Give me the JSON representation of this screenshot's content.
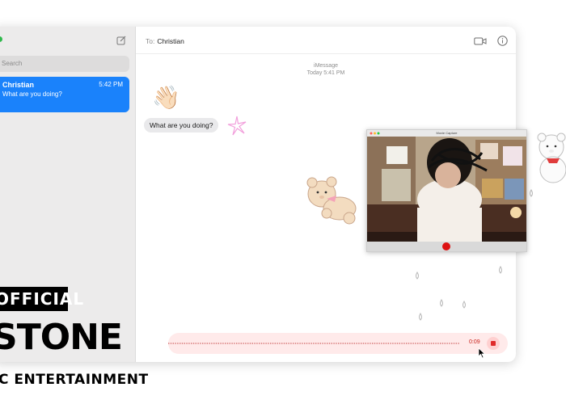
{
  "sidebar": {
    "search_placeholder": "Search",
    "conversations": [
      {
        "name": "Christian",
        "time": "5:42 PM",
        "preview": "What are you doing?"
      }
    ]
  },
  "header": {
    "to_label": "To:",
    "recipient": "Christian"
  },
  "thread": {
    "service": "iMessage",
    "timestamp": "Today 5:41 PM",
    "messages": [
      {
        "type": "emoji",
        "text": "👋🏻"
      },
      {
        "type": "received",
        "text": "What are you doing?"
      }
    ]
  },
  "recording": {
    "elapsed": "0:09",
    "accent": "#e02a2a"
  },
  "video_window": {
    "title": "Movie Capture"
  },
  "watermark": {
    "line1": "OFFICIAL",
    "line2": "STONE",
    "line3": "C ENTERTAINMENT"
  },
  "colors": {
    "accent_blue": "#1a82fb",
    "bubble_gray": "#e9e9eb"
  }
}
